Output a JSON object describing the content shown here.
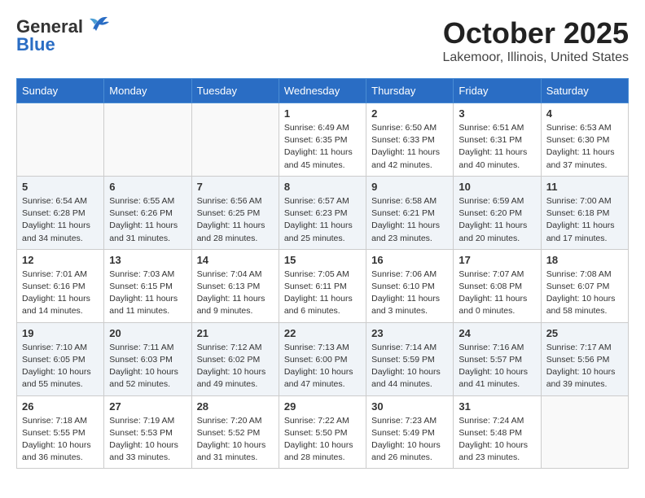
{
  "logo": {
    "general": "General",
    "blue": "Blue"
  },
  "title": "October 2025",
  "location": "Lakemoor, Illinois, United States",
  "days_of_week": [
    "Sunday",
    "Monday",
    "Tuesday",
    "Wednesday",
    "Thursday",
    "Friday",
    "Saturday"
  ],
  "weeks": [
    {
      "shaded": false,
      "days": [
        {
          "num": "",
          "info": ""
        },
        {
          "num": "",
          "info": ""
        },
        {
          "num": "",
          "info": ""
        },
        {
          "num": "1",
          "info": "Sunrise: 6:49 AM\nSunset: 6:35 PM\nDaylight: 11 hours\nand 45 minutes."
        },
        {
          "num": "2",
          "info": "Sunrise: 6:50 AM\nSunset: 6:33 PM\nDaylight: 11 hours\nand 42 minutes."
        },
        {
          "num": "3",
          "info": "Sunrise: 6:51 AM\nSunset: 6:31 PM\nDaylight: 11 hours\nand 40 minutes."
        },
        {
          "num": "4",
          "info": "Sunrise: 6:53 AM\nSunset: 6:30 PM\nDaylight: 11 hours\nand 37 minutes."
        }
      ]
    },
    {
      "shaded": true,
      "days": [
        {
          "num": "5",
          "info": "Sunrise: 6:54 AM\nSunset: 6:28 PM\nDaylight: 11 hours\nand 34 minutes."
        },
        {
          "num": "6",
          "info": "Sunrise: 6:55 AM\nSunset: 6:26 PM\nDaylight: 11 hours\nand 31 minutes."
        },
        {
          "num": "7",
          "info": "Sunrise: 6:56 AM\nSunset: 6:25 PM\nDaylight: 11 hours\nand 28 minutes."
        },
        {
          "num": "8",
          "info": "Sunrise: 6:57 AM\nSunset: 6:23 PM\nDaylight: 11 hours\nand 25 minutes."
        },
        {
          "num": "9",
          "info": "Sunrise: 6:58 AM\nSunset: 6:21 PM\nDaylight: 11 hours\nand 23 minutes."
        },
        {
          "num": "10",
          "info": "Sunrise: 6:59 AM\nSunset: 6:20 PM\nDaylight: 11 hours\nand 20 minutes."
        },
        {
          "num": "11",
          "info": "Sunrise: 7:00 AM\nSunset: 6:18 PM\nDaylight: 11 hours\nand 17 minutes."
        }
      ]
    },
    {
      "shaded": false,
      "days": [
        {
          "num": "12",
          "info": "Sunrise: 7:01 AM\nSunset: 6:16 PM\nDaylight: 11 hours\nand 14 minutes."
        },
        {
          "num": "13",
          "info": "Sunrise: 7:03 AM\nSunset: 6:15 PM\nDaylight: 11 hours\nand 11 minutes."
        },
        {
          "num": "14",
          "info": "Sunrise: 7:04 AM\nSunset: 6:13 PM\nDaylight: 11 hours\nand 9 minutes."
        },
        {
          "num": "15",
          "info": "Sunrise: 7:05 AM\nSunset: 6:11 PM\nDaylight: 11 hours\nand 6 minutes."
        },
        {
          "num": "16",
          "info": "Sunrise: 7:06 AM\nSunset: 6:10 PM\nDaylight: 11 hours\nand 3 minutes."
        },
        {
          "num": "17",
          "info": "Sunrise: 7:07 AM\nSunset: 6:08 PM\nDaylight: 11 hours\nand 0 minutes."
        },
        {
          "num": "18",
          "info": "Sunrise: 7:08 AM\nSunset: 6:07 PM\nDaylight: 10 hours\nand 58 minutes."
        }
      ]
    },
    {
      "shaded": true,
      "days": [
        {
          "num": "19",
          "info": "Sunrise: 7:10 AM\nSunset: 6:05 PM\nDaylight: 10 hours\nand 55 minutes."
        },
        {
          "num": "20",
          "info": "Sunrise: 7:11 AM\nSunset: 6:03 PM\nDaylight: 10 hours\nand 52 minutes."
        },
        {
          "num": "21",
          "info": "Sunrise: 7:12 AM\nSunset: 6:02 PM\nDaylight: 10 hours\nand 49 minutes."
        },
        {
          "num": "22",
          "info": "Sunrise: 7:13 AM\nSunset: 6:00 PM\nDaylight: 10 hours\nand 47 minutes."
        },
        {
          "num": "23",
          "info": "Sunrise: 7:14 AM\nSunset: 5:59 PM\nDaylight: 10 hours\nand 44 minutes."
        },
        {
          "num": "24",
          "info": "Sunrise: 7:16 AM\nSunset: 5:57 PM\nDaylight: 10 hours\nand 41 minutes."
        },
        {
          "num": "25",
          "info": "Sunrise: 7:17 AM\nSunset: 5:56 PM\nDaylight: 10 hours\nand 39 minutes."
        }
      ]
    },
    {
      "shaded": false,
      "days": [
        {
          "num": "26",
          "info": "Sunrise: 7:18 AM\nSunset: 5:55 PM\nDaylight: 10 hours\nand 36 minutes."
        },
        {
          "num": "27",
          "info": "Sunrise: 7:19 AM\nSunset: 5:53 PM\nDaylight: 10 hours\nand 33 minutes."
        },
        {
          "num": "28",
          "info": "Sunrise: 7:20 AM\nSunset: 5:52 PM\nDaylight: 10 hours\nand 31 minutes."
        },
        {
          "num": "29",
          "info": "Sunrise: 7:22 AM\nSunset: 5:50 PM\nDaylight: 10 hours\nand 28 minutes."
        },
        {
          "num": "30",
          "info": "Sunrise: 7:23 AM\nSunset: 5:49 PM\nDaylight: 10 hours\nand 26 minutes."
        },
        {
          "num": "31",
          "info": "Sunrise: 7:24 AM\nSunset: 5:48 PM\nDaylight: 10 hours\nand 23 minutes."
        },
        {
          "num": "",
          "info": ""
        }
      ]
    }
  ]
}
